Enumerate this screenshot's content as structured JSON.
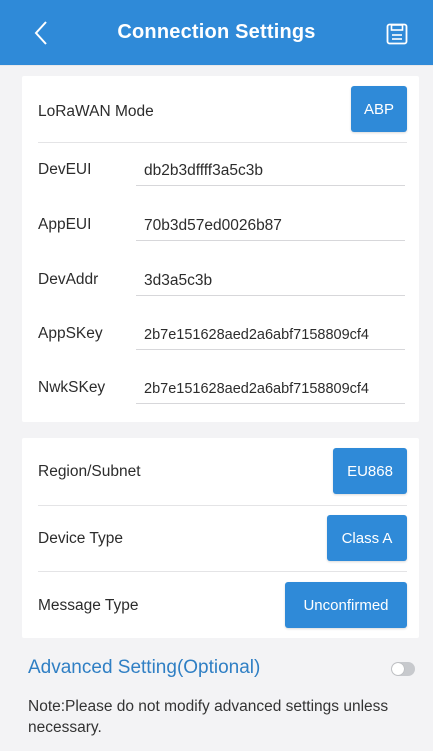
{
  "header": {
    "title": "Connection Settings",
    "color": "#2f8ad8"
  },
  "lorawan": {
    "mode_label": "LoRaWAN Mode",
    "mode_value": "ABP",
    "fields": [
      {
        "label": "DevEUI",
        "value": "db2b3dffff3a5c3b"
      },
      {
        "label": "AppEUI",
        "value": "70b3d57ed0026b87"
      },
      {
        "label": "DevAddr",
        "value": "3d3a5c3b"
      },
      {
        "label": "AppSKey",
        "value": "2b7e151628aed2a6abf7158809cf4"
      },
      {
        "label": "NwkSKey",
        "value": "2b7e151628aed2a6abf7158809cf4"
      }
    ]
  },
  "network": {
    "region_label": "Region/Subnet",
    "region_value": "EU868",
    "device_type_label": "Device Type",
    "device_type_value": "Class A",
    "message_type_label": "Message Type",
    "message_type_value": "Unconfirmed"
  },
  "advanced": {
    "title": "Advanced Setting(Optional)",
    "enabled": false,
    "note": "Note:Please do not modify advanced settings unless necessary."
  },
  "icons": {
    "back": "chevron-left-icon",
    "save": "save-icon"
  }
}
